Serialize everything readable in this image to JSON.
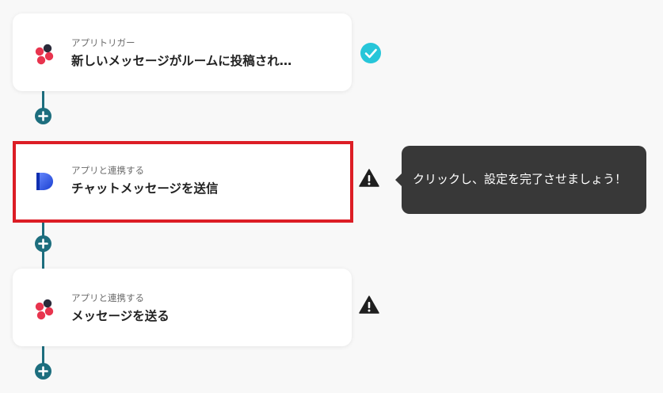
{
  "flow": {
    "steps": [
      {
        "subtitle": "アプリトリガー",
        "title": "新しいメッセージがルームに投稿され…",
        "app_icon": "chatwork-icon",
        "status": "check-icon"
      },
      {
        "subtitle": "アプリと連携する",
        "title": "チャットメッセージを送信",
        "app_icon": "dialogue-app-icon",
        "status": "warning-icon"
      },
      {
        "subtitle": "アプリと連携する",
        "title": "メッセージを送る",
        "app_icon": "chatwork-icon",
        "status": "warning-icon"
      }
    ],
    "add_button_icon": "plus-icon"
  },
  "tooltip": {
    "text": "クリックし、設定を完了させましょう！"
  },
  "colors": {
    "connector": "#1d6e7e",
    "highlight_border": "#dc1d25",
    "check": "#27c6d9",
    "tooltip_bg": "#383838"
  }
}
